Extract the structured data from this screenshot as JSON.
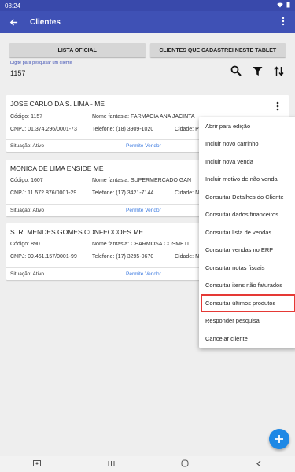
{
  "status_bar": {
    "time": "08:24"
  },
  "app_bar": {
    "title": "Clientes"
  },
  "tabs": [
    {
      "label": "LISTA OFICIAL"
    },
    {
      "label": "CLIENTES QUE CADASTREI NESTE TABLET"
    }
  ],
  "search": {
    "label": "Digite para pesquisar um cliente",
    "value": "1157"
  },
  "clients": [
    {
      "name": "JOSE CARLO DA S. LIMA - ME",
      "code": "Código: 1157",
      "fantasy": "Nome fantasia: FARMACIA ANA JACINTA",
      "cnpj": "CNPJ: 01.374.296/0001-73",
      "phone": "Telefone: (18) 3909-1020",
      "city": "Cidade: P",
      "situation": "Situação: Ativo",
      "permit": "Permite Vendor"
    },
    {
      "name": "MONICA DE LIMA ENSIDE ME",
      "code": "Código: 1607",
      "fantasy": "Nome fantasia: SUPERMERCADO GAN",
      "cnpj": "CNPJ: 11.572.876/0001-29",
      "phone": "Telefone: (17) 3421-7144",
      "city": "Cidade: N",
      "situation": "Situação: Ativo",
      "permit": "Permite Vendor"
    },
    {
      "name": "S. R. MENDES GOMES CONFECCOES ME",
      "code": "Código: 890",
      "fantasy": "Nome fantasia: CHARMOSA COSMETI",
      "cnpj": "CNPJ: 09.461.157/0001-99",
      "phone": "Telefone: (17) 3295-0670",
      "city": "Cidade: N",
      "situation": "Situação: Ativo",
      "permit": "Permite Vendor"
    }
  ],
  "menu": {
    "items": [
      "Abrir para edição",
      "Incluir novo carrinho",
      "Incluir nova venda",
      "Incluir motivo de não venda",
      "Consultar Detalhes do Cliente",
      "Consultar dados financeiros",
      "Consultar lista de vendas",
      "Consultar vendas no ERP",
      "Consultar notas fiscais",
      "Consultar itens não faturados",
      "Consultar últimos produtos",
      "Responder pesquisa",
      "Cancelar cliente"
    ],
    "highlight_color": "#e53935"
  },
  "colors": {
    "primary": "#3f51b5",
    "status": "#3949ab",
    "fab": "#1e88e5",
    "link": "#3d7be0"
  },
  "icons": [
    "back-arrow-icon",
    "overflow-menu-icon",
    "search-icon",
    "filter-icon",
    "sort-icon",
    "add-icon"
  ]
}
